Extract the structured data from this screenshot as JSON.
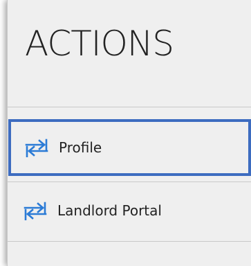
{
  "panel": {
    "title": "ACTIONS",
    "items": [
      {
        "label": "Profile",
        "icon": "swap-arrows-icon",
        "selected": true
      },
      {
        "label": "Landlord Portal",
        "icon": "swap-arrows-icon",
        "selected": false
      }
    ]
  },
  "colors": {
    "accent": "#3d6cc0",
    "icon": "#2b7bd6",
    "panel_bg": "#efefef",
    "divider": "#c9c9c9"
  }
}
